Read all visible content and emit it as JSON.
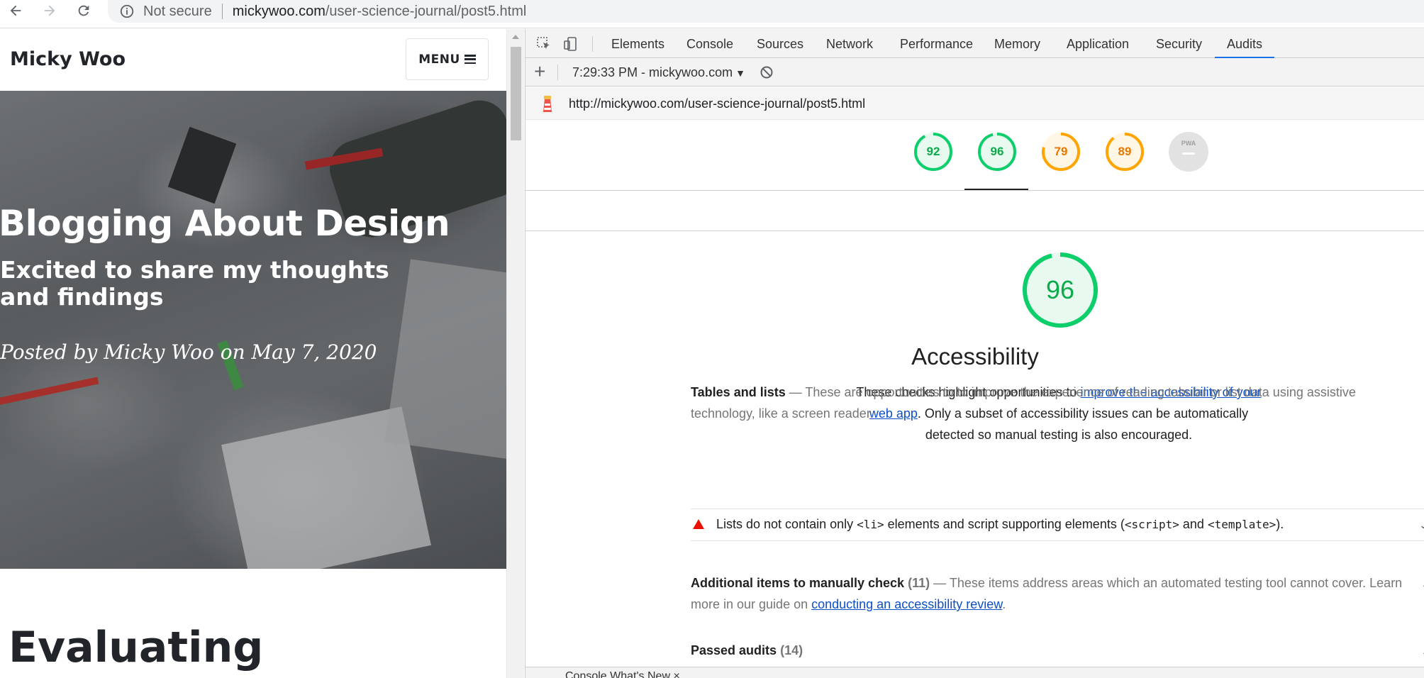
{
  "browser": {
    "security_label": "Not secure",
    "url_host": "mickywoo.com",
    "url_path": "/user-science-journal/post5.html"
  },
  "page": {
    "brand": "Micky Woo",
    "menu_label": "MENU",
    "hero_title": "Blogging About Design",
    "hero_subtitle": "Excited to share my thoughts and findings",
    "hero_meta": "Posted by Micky Woo on May 7, 2020",
    "section_heading": "Evaluating"
  },
  "devtools": {
    "tabs": [
      "Elements",
      "Console",
      "Sources",
      "Network",
      "Performance",
      "Memory",
      "Application",
      "Security",
      "Audits"
    ],
    "active_tab": "Audits",
    "report_label": "7:29:33 PM - mickywoo.com",
    "audited_url": "http://mickywoo.com/user-science-journal/post5.html",
    "scores": [
      {
        "value": 92,
        "color": "#0cce6b",
        "text_color": "#0aab4a"
      },
      {
        "value": 96,
        "color": "#0cce6b",
        "text_color": "#0aab4a"
      },
      {
        "value": 79,
        "color": "#ffa400",
        "text_color": "#e67700"
      },
      {
        "value": 89,
        "color": "#ffa400",
        "text_color": "#e67700"
      }
    ],
    "pwa_label": "PWA",
    "category": {
      "score": 96,
      "title": "Accessibility",
      "desc_before": "These checks highlight opportunities to ",
      "desc_link": "improve the accessibility of your web app",
      "desc_after": ". Only a subset of accessibility issues can be automatically detected so manual testing is also encouraged."
    },
    "group_tables": {
      "title": "Tables and lists",
      "desc": "These are opportunities to to improve the experience of reading tabular or list data using assistive technology, like a screen reader."
    },
    "failed_audit": {
      "text_before": "Lists do not contain only ",
      "code_li": "<li>",
      "text_mid": " elements and script supporting elements (",
      "code_script": "<script>",
      "text_and": " and ",
      "code_template": "<template>",
      "text_after": ")."
    },
    "group_manual": {
      "title": "Additional items to manually check",
      "count": "(11)",
      "desc": "These items address areas which an automated testing tool cannot cover. Learn more in our guide on ",
      "link": "conducting an accessibility review",
      "after": "."
    },
    "group_passed": {
      "title": "Passed audits",
      "count": "(14)"
    },
    "drawer_label": "Console   What's New ×"
  },
  "colors": {
    "pass": "#0cce6b",
    "average": "#ffa400",
    "fail": "#eb0f00",
    "link": "#0c50c7",
    "active_tab_underline": "#1a73e8"
  }
}
